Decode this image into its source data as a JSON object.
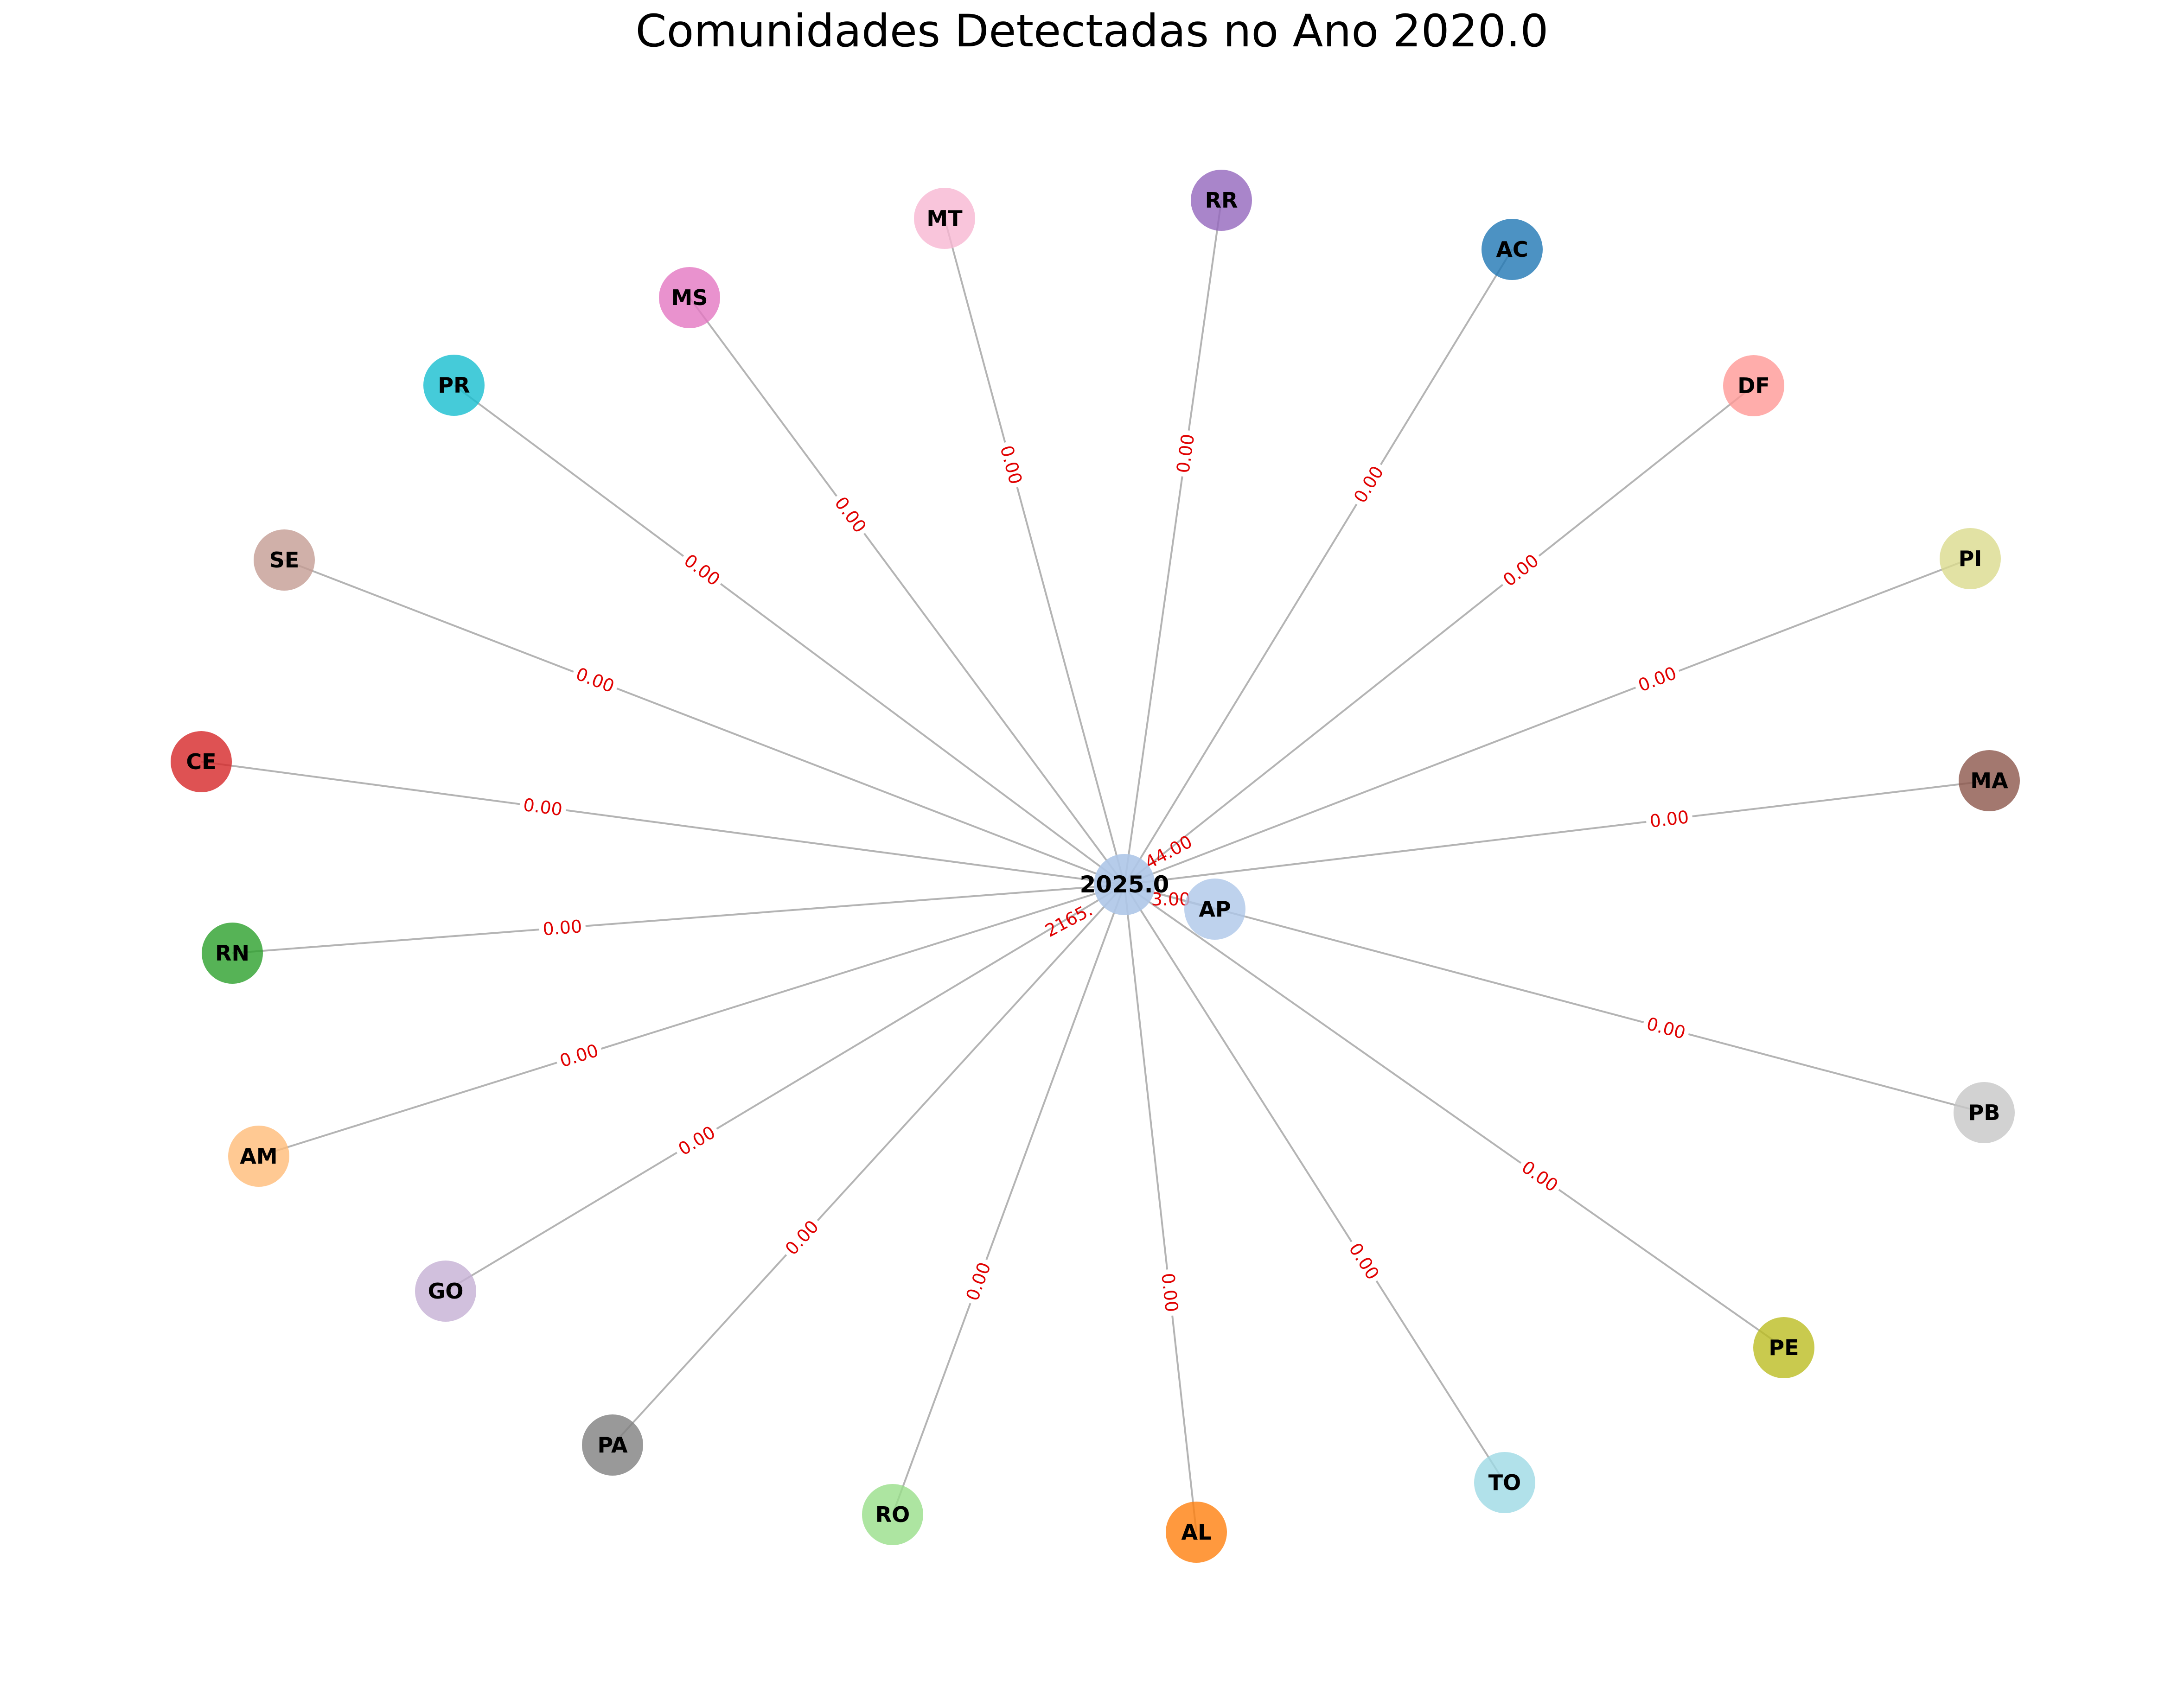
{
  "title": "Comunidades Detectadas no Ano 2020.0",
  "chart_data": {
    "type": "network",
    "layout": "spring",
    "center_node": {
      "label": "2025.0",
      "color": "#aec7e8"
    },
    "nodes": [
      {
        "id": "AC",
        "color": "#1f77b4"
      },
      {
        "id": "AL",
        "color": "#ff7f0e"
      },
      {
        "id": "AM",
        "color": "#ffbb78"
      },
      {
        "id": "AP",
        "color": "#aec7e8"
      },
      {
        "id": "CE",
        "color": "#d62728"
      },
      {
        "id": "DF",
        "color": "#ff9896"
      },
      {
        "id": "GO",
        "color": "#c5b0d5"
      },
      {
        "id": "MA",
        "color": "#8c564b"
      },
      {
        "id": "MS",
        "color": "#e377c2"
      },
      {
        "id": "MT",
        "color": "#f7b6d2"
      },
      {
        "id": "PA",
        "color": "#7f7f7f"
      },
      {
        "id": "PB",
        "color": "#c7c7c7"
      },
      {
        "id": "PE",
        "color": "#bcbd22"
      },
      {
        "id": "PI",
        "color": "#dbdb8d"
      },
      {
        "id": "PR",
        "color": "#17becf"
      },
      {
        "id": "RN",
        "color": "#2ca02c"
      },
      {
        "id": "RO",
        "color": "#98df8a"
      },
      {
        "id": "RR",
        "color": "#9467bd"
      },
      {
        "id": "SE",
        "color": "#c49c94"
      },
      {
        "id": "TO",
        "color": "#9edae5"
      }
    ],
    "edges": [
      {
        "source": "center",
        "target": "MT",
        "weight": "0.00"
      },
      {
        "source": "center",
        "target": "RR",
        "weight": "0.00"
      },
      {
        "source": "center",
        "target": "MS",
        "weight": "0.00"
      },
      {
        "source": "center",
        "target": "AC",
        "weight": "0.00"
      },
      {
        "source": "center",
        "target": "PR",
        "weight": "0.00"
      },
      {
        "source": "center",
        "target": "DF",
        "weight": "0.00"
      },
      {
        "source": "center",
        "target": "SE",
        "weight": "0.00"
      },
      {
        "source": "center",
        "target": "PI",
        "weight": "0.00"
      },
      {
        "source": "center",
        "target": "CE",
        "weight": "0.00"
      },
      {
        "source": "center",
        "target": "MA",
        "weight": "0.00"
      },
      {
        "source": "center",
        "target": "RN",
        "weight": "0.00"
      },
      {
        "source": "center",
        "target": "AM",
        "weight": "0.00"
      },
      {
        "source": "center",
        "target": "PB",
        "weight": "0.00"
      },
      {
        "source": "center",
        "target": "GO",
        "weight": "0.00"
      },
      {
        "source": "center",
        "target": "PE",
        "weight": "0.00"
      },
      {
        "source": "center",
        "target": "PA",
        "weight": "0.00"
      },
      {
        "source": "center",
        "target": "TO",
        "weight": "0.00"
      },
      {
        "source": "center",
        "target": "RO",
        "weight": "0.00"
      },
      {
        "source": "center",
        "target": "AL",
        "weight": "0.00"
      },
      {
        "source": "center",
        "target": "AP",
        "weight": "0.00"
      }
    ],
    "extra_edge_labels": [
      "44.00",
      "2165.",
      "3.00"
    ]
  }
}
